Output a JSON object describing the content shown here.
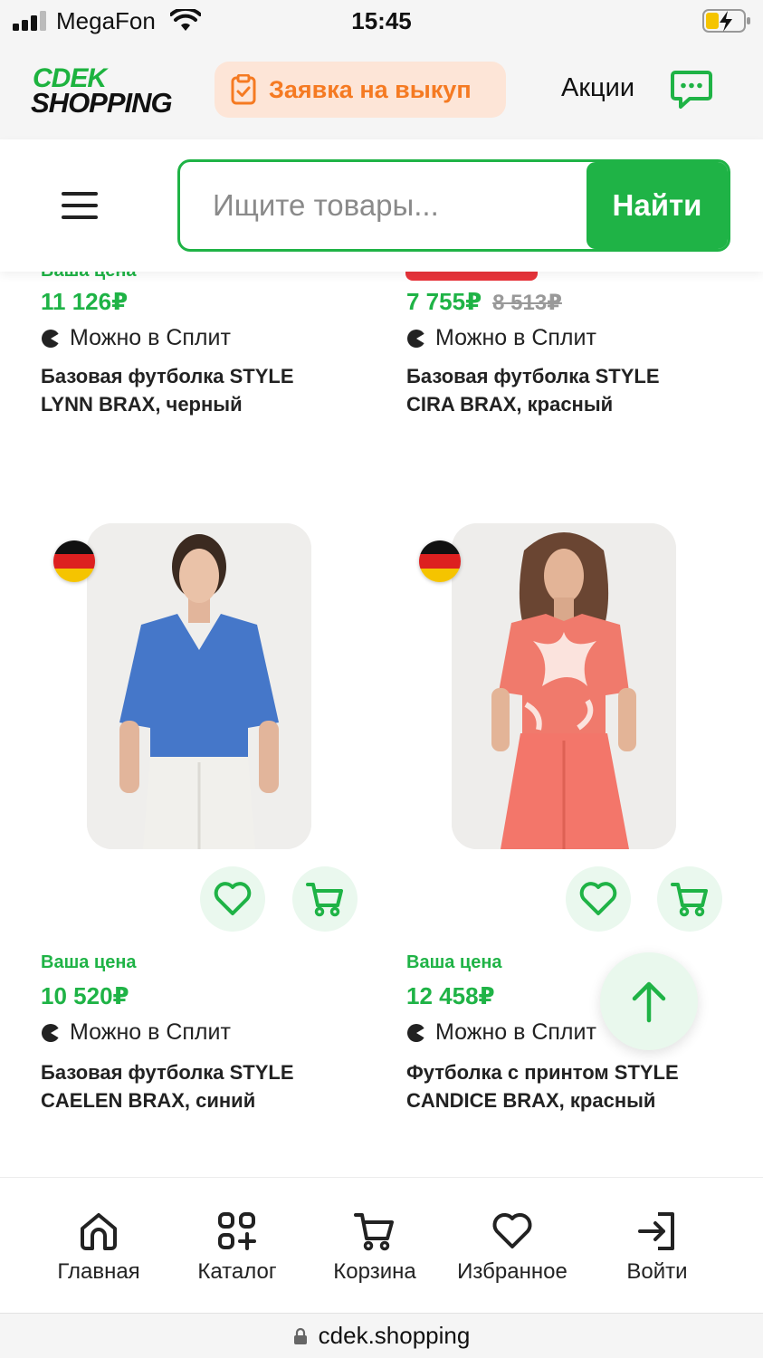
{
  "status_bar": {
    "carrier": "MegaFon",
    "time": "15:45"
  },
  "header": {
    "logo_line1": "CDEK",
    "logo_line2": "SHOPPING",
    "request_button": "Заявка на выкуп",
    "promo_link": "Акции",
    "accent_color": "#1fb346",
    "orange_color": "#f57a22"
  },
  "search": {
    "placeholder": "Ищите товары...",
    "button": "Найти"
  },
  "products": [
    {
      "price_label": "Ваша цена",
      "price": "11 126₽",
      "old_price": "",
      "split": "Можно в Сплит",
      "title_line1": "Базовая футболка STYLE",
      "title_line2": "LYNN BRAX, черный"
    },
    {
      "price_label": "",
      "price": "7 755₽",
      "old_price": "8 513₽",
      "split": "Можно в Сплит",
      "title_line1": "Базовая футболка STYLE",
      "title_line2": "CIRA BRAX, красный"
    },
    {
      "price_label": "Ваша цена",
      "price": "10 520₽",
      "old_price": "",
      "split": "Можно в Сплит",
      "title_line1": "Базовая футболка STYLE",
      "title_line2": "CAELEN BRAX, синий",
      "image_icon": "blue-tshirt-photo",
      "flag_icon": "germany-flag-icon"
    },
    {
      "price_label": "Ваша цена",
      "price": "12 458₽",
      "old_price": "",
      "split": "Можно в Сплит",
      "title_line1": "Футболка с принтом STYLE",
      "title_line2": "CANDICE BRAX, красный",
      "image_icon": "floral-tshirt-photo",
      "flag_icon": "germany-flag-icon"
    }
  ],
  "bottom_nav": [
    {
      "label": "Главная",
      "icon": "home-icon"
    },
    {
      "label": "Каталог",
      "icon": "catalog-icon"
    },
    {
      "label": "Корзина",
      "icon": "cart-icon"
    },
    {
      "label": "Избранное",
      "icon": "heart-icon"
    },
    {
      "label": "Войти",
      "icon": "login-icon"
    }
  ],
  "url_bar": {
    "url": "cdek.shopping"
  }
}
